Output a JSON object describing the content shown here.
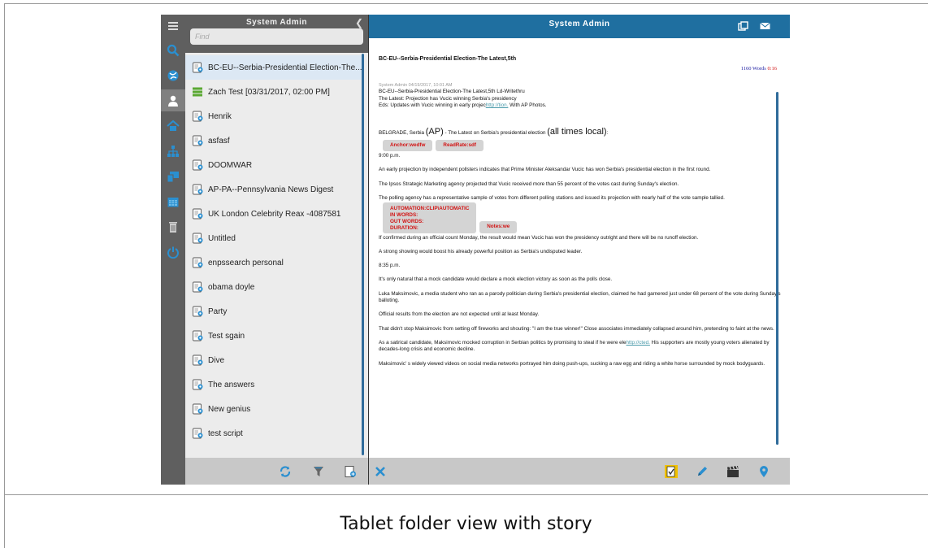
{
  "caption": "Tablet folder view with story",
  "folder_panel": {
    "title": "System Admin",
    "find_placeholder": "Find",
    "items": [
      {
        "label": "BC-EU--Serbia-Presidential Election-The...",
        "icon": "story-icon",
        "selected": true
      },
      {
        "label": "Zach Test [03/31/2017, 02:00 PM]",
        "icon": "rundown-icon"
      },
      {
        "label": "Henrik",
        "icon": "story-icon"
      },
      {
        "label": "asfasf",
        "icon": "story-icon"
      },
      {
        "label": "DOOMWAR",
        "icon": "story-icon"
      },
      {
        "label": "AP-PA--Pennsylvania News Digest",
        "icon": "story-icon"
      },
      {
        "label": "UK London Celebrity Reax -4087581",
        "icon": "story-icon"
      },
      {
        "label": "Untitled",
        "icon": "story-icon"
      },
      {
        "label": "enpssearch personal",
        "icon": "story-icon"
      },
      {
        "label": "obama doyle",
        "icon": "story-icon"
      },
      {
        "label": "Party",
        "icon": "story-icon"
      },
      {
        "label": "Test sgain",
        "icon": "story-icon"
      },
      {
        "label": "Dive",
        "icon": "story-icon"
      },
      {
        "label": "The answers",
        "icon": "story-icon"
      },
      {
        "label": "New genius",
        "icon": "story-icon"
      },
      {
        "label": "test script",
        "icon": "story-icon"
      }
    ]
  },
  "story_panel": {
    "title": "System Admin",
    "slug": "BC-EU--Serbia-Presidential Election-The Latest,5th",
    "word_count": "1160",
    "words_label": "Words",
    "duration": "0:16",
    "meta_line": "System Admin 04/19/2017, 10:01 AM",
    "header_lines": [
      "BC-EU--Serbia-Presidential Election-The Latest,5th Ld-Writethru",
      "The Latest: Projection has Vucic winning Serbia's presidency"
    ],
    "eds_prefix": "Eds: Updates with Vucic winning in early projec",
    "eds_link": "http://tion.",
    "eds_suffix": " With AP Photos.",
    "dateline_a": "BELGRADE, Serbia ",
    "dateline_ap": "(AP)",
    "dateline_b": " - The Latest on Serbia's presidential election ",
    "dateline_big": "(all times local)",
    "dateline_colon": ":",
    "tag_anchor": "Anchor:wedfw",
    "tag_readrate": "ReadRate:sdf",
    "time1": "9:00 p.m.",
    "p1": "An early projection by independent pollsters indicates that Prime Minister Aleksandar Vucic has won Serbia's presidential election in the first round.",
    "p2": "The Ipsos Strategic Marketing agency projected that Vucic received more than 55 percent of the votes cast during Sunday's election.",
    "p3": "The polling agency has a representative sample of votes from different polling stations and issued its projection with nearly half of the vote sample tallied.",
    "automation_lines": [
      "AUTOMATION:CLIP\\AUTOMATIC",
      "IN WORDS:",
      "OUT WORDS:",
      "DURATION:"
    ],
    "tag_notes": "Notes:we",
    "p4": "If confirmed during an official count Monday, the result would mean Vucic has won the presidency outright and there will be no runoff election.",
    "p5": "A strong showing would boost his already powerful position as Serbia's undisputed leader.",
    "time2": "8:35 p.m.",
    "p6": "It's only natural that a mock candidate would declare a mock election victory as soon as the polls close.",
    "p7": "Luka Maksimovic, a media student who ran as a parody politician during Serbia's presidential election, claimed he had garnered just under 68 percent of the vote during Sunday's balloting.",
    "p8": "Official results from the election are not expected until at least Monday.",
    "p9": "That didn't stop Maksimovic from setting off fireworks and shouting: \"I am the true winner!\" Close associates immediately collapsed around him, pretending to faint at the news.",
    "p10_a": "As a satirical candidate, Maksimovic mocked corruption in Serbian politics by promising to steal if he were ele",
    "p10_link": "http://cted.",
    "p10_b": " His supporters are mostly young voters alienated by decades-long crisis and economic decline.",
    "p11": "Maksimovic' s widely viewed videos on social media networks portrayed him doing push-ups, sucking a raw egg and riding a white horse surrounded by mock bodyguards."
  },
  "colors": {
    "header_blue": "#1f6fa0",
    "rail_gray": "#5f5f5f",
    "tag_red": "#d21313",
    "icon_blue": "#2a8fd0"
  }
}
